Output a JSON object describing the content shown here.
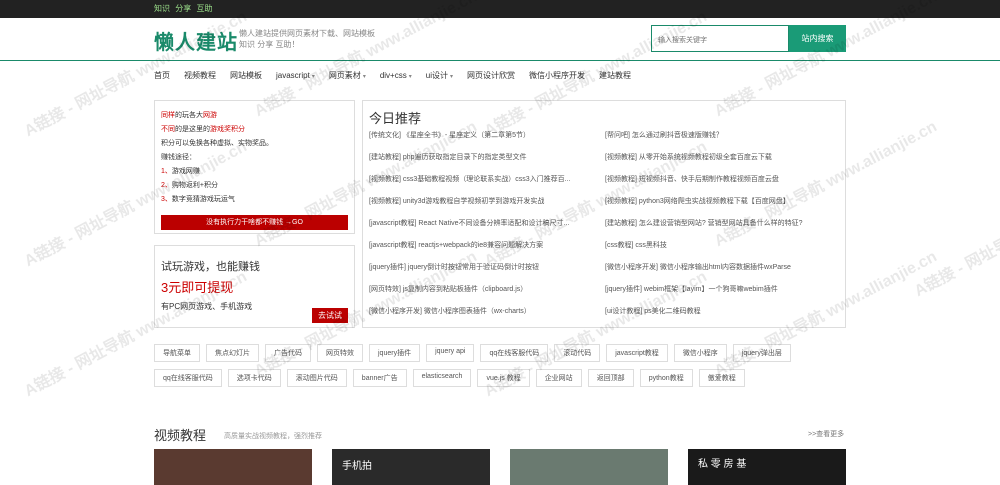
{
  "topbar": {
    "items": [
      "知识",
      "分享",
      "互助"
    ]
  },
  "header": {
    "logo": "懒人建站",
    "desc_line1": "懒人建站提供网页素材下载、网站模板",
    "desc_line2": "知识 分享 互助！"
  },
  "search": {
    "placeholder": "输入搜索关键字",
    "button": "站内搜索"
  },
  "nav": [
    {
      "label": "首页"
    },
    {
      "label": "视频教程"
    },
    {
      "label": "网站模板"
    },
    {
      "label": "javascript",
      "caret": "▾"
    },
    {
      "label": "网页素材",
      "caret": "▾"
    },
    {
      "label": "div+css",
      "caret": "▾"
    },
    {
      "label": "ui设计",
      "caret": "▾"
    },
    {
      "label": "网页设计欣赏"
    },
    {
      "label": "微信小程序开发"
    },
    {
      "label": "建站教程"
    }
  ],
  "promo": {
    "line1a": "同样",
    "line1b": "的玩各大",
    "line1c": "网游",
    "line2a": "不同",
    "line2b": "的是这里的",
    "line2c": "游戏奖积分",
    "line3": "积分可以免换各种虚拟、实物奖品。",
    "line4": "赚钱途径：",
    "item1n": "1、",
    "item1": "游戏网赚",
    "item2n": "2、",
    "item2": "购物返利+积分",
    "item3n": "3、",
    "item3": "数字竞猜游戏玩运气",
    "button": "没有执行力干啥都不赚钱 →GO"
  },
  "game": {
    "title": "试玩游戏，也能赚钱",
    "sub": "3元即可提现",
    "desc": "有PC网页游戏、手机游戏",
    "button": "去试试"
  },
  "today": {
    "title": "今日推荐",
    "left": [
      "[传统文化] 《星座全书》- 星座定义（第二章第5节）",
      "[建站教程] php遍历获取指定目录下的指定类型文件",
      "[视频教程] css3基础教程视频（理论联系实战）css3入门推荐百...",
      "[视频教程] unity3d游戏教程自学视频初学到游戏开发实战",
      "[javascript教程] React Native不同设备分辨率适配和设计稿尺寸...",
      "[javascript教程] reactjs+webpack的ie8兼容问题解决方案",
      "[jquery插件] jquery倒计时按钮常用于验证码倒计时按钮",
      "[网页特效] js复制内容到粘贴板插件（clipboard.js）",
      "[微信小程序开发] 微信小程序图表插件（wx-charts）"
    ],
    "right": [
      "[帮问吧] 怎么通过刷抖音极速版赚钱？",
      "[视频教程] 从零开始系统视频教程初级全套百度云下载",
      "[视频教程] 短视频抖音、快手后期制作教程视频百度云盘",
      "[视频教程] python3网络爬虫实战视频教程下载【百度网盘】",
      "[建站教程] 怎么建设营销型网站? 营销型网站具备什么样的特征?",
      "[css教程] css黑科技",
      "[微信小程序开发] 微信小程序输出html内容数据插件wxParse",
      "[jquery插件] webim框架【layim】一个狗哥嘛webim插件",
      "[ui设计教程] ps美化二维码教程"
    ]
  },
  "tags": [
    "导航菜单",
    "焦点幻灯片",
    "广告代码",
    "网页特效",
    "jquery插件",
    "jquery api",
    "qq在线客服代码",
    "滚动代码",
    "javascript教程",
    "微信小程序",
    "jquery弹出层",
    "qq在线客服代码",
    "选项卡代码",
    "滚动图片代码",
    "banner广告",
    "elasticsearch",
    "vue.js 教程",
    "企业网站",
    "返回顶部",
    "python教程",
    "傲爱教程"
  ],
  "section": {
    "title": "视频教程",
    "sub": "高质量实战视频教程，强烈推荐",
    "more": ">>查看更多"
  },
  "thumbs": [
    {
      "text": ""
    },
    {
      "text": "手机拍"
    },
    {
      "text": ""
    },
    {
      "text": "私 零 房 基"
    }
  ],
  "watermark": "A链接 - 网址导航 www.allianjie.cn",
  "colors": {
    "brand": "#1a8a6a",
    "accent_red": "#c00",
    "topbar": "#222"
  }
}
